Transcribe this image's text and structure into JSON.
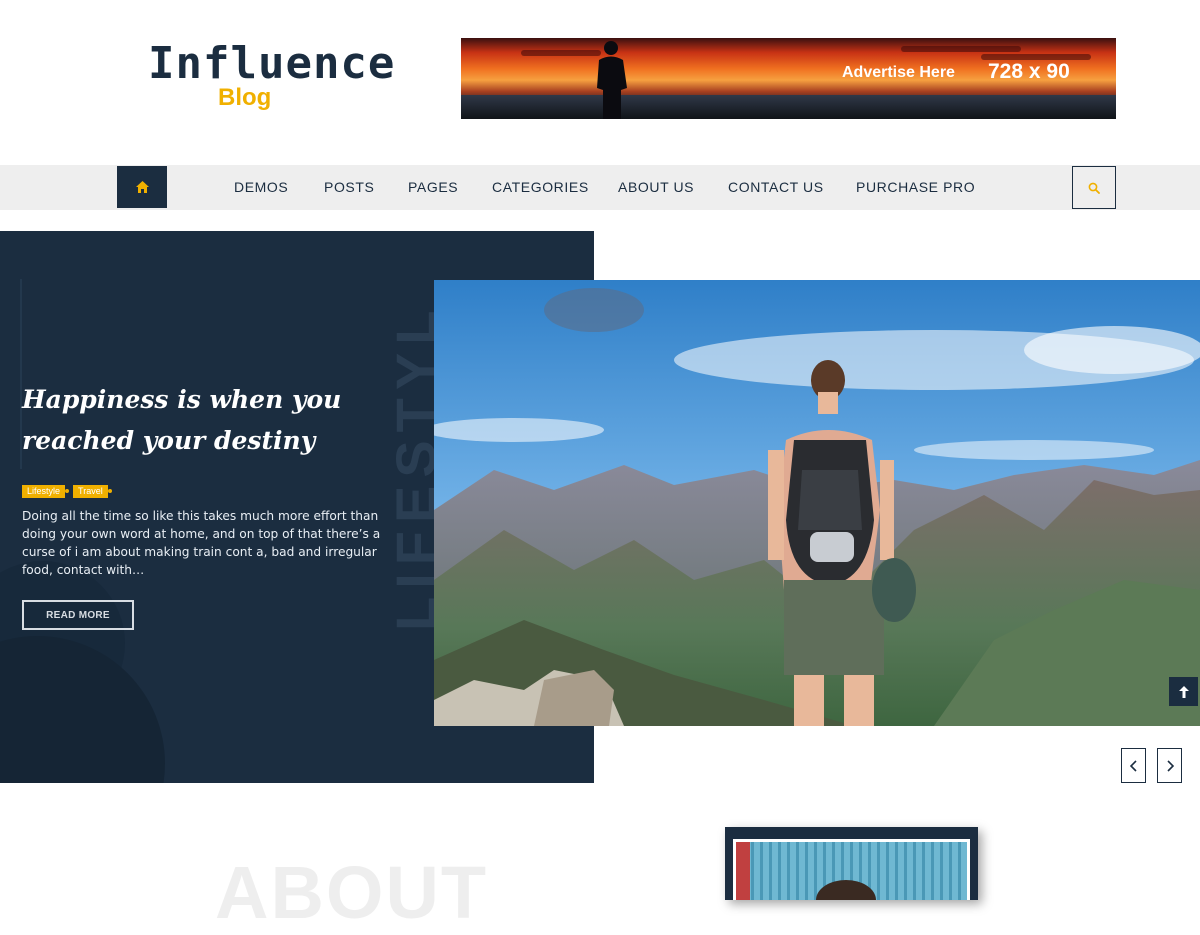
{
  "header": {
    "logo_main": "Influence",
    "logo_sub": "Blog",
    "ad_text": "Advertise Here",
    "ad_size": "728 x 90"
  },
  "nav": {
    "home_icon": "home-icon",
    "items": [
      "DEMOS",
      "POSTS",
      "PAGES",
      "CATEGORIES",
      "ABOUT US",
      "CONTACT US",
      "PURCHASE PRO"
    ],
    "search_icon": "search-icon"
  },
  "hero": {
    "vertical_word": "LIFESTYL",
    "title": "Happiness is when you reached your destiny",
    "tags": [
      "Lifestyle",
      "Travel"
    ],
    "excerpt": "Doing all the time so like this takes much more effort than doing your own word at home, and on top of that there’s a curse of i am about making train cont a, bad and irregular food, contact with…",
    "read_more": "READ MORE",
    "prev_icon": "chevron-left-icon",
    "next_icon": "chevron-right-icon",
    "scroll_top_icon": "arrow-up-icon"
  },
  "about": {
    "bg_word": "ABOUT"
  },
  "colors": {
    "navy": "#1b2d40",
    "accent": "#f0b000",
    "nav_bg": "#eeeeee"
  }
}
